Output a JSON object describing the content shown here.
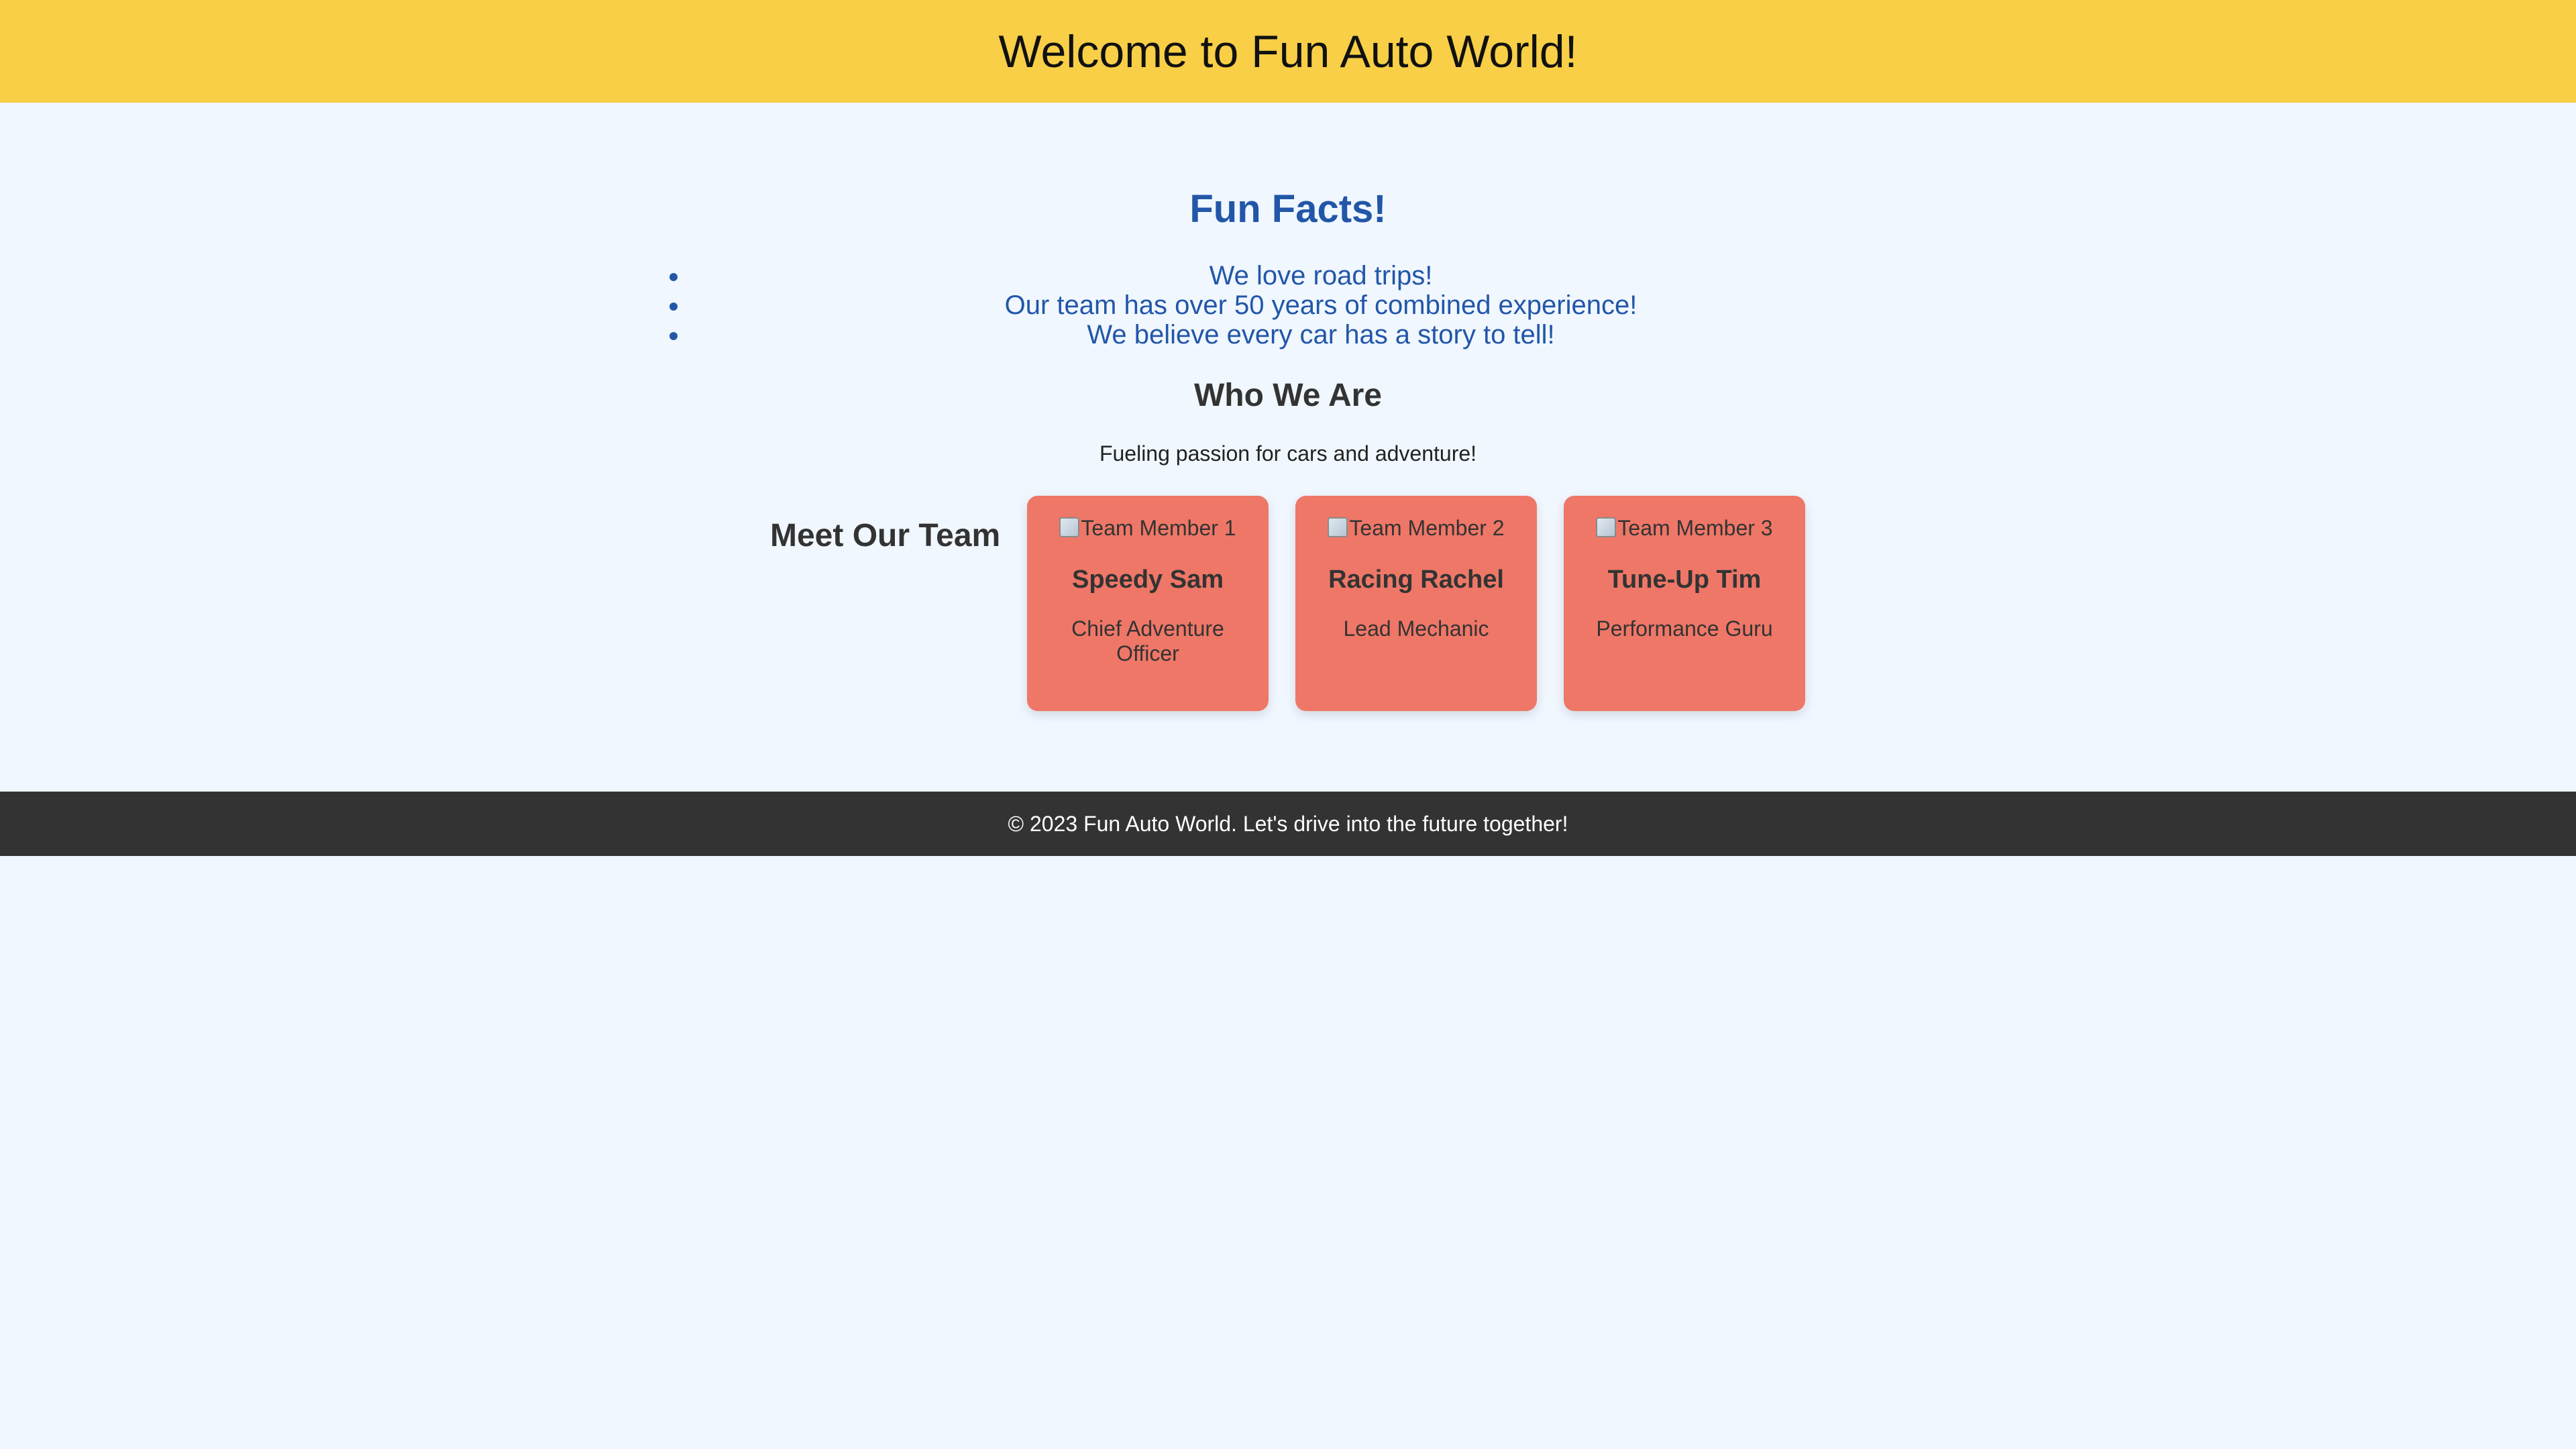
{
  "header": {
    "title": "Welcome to Fun Auto World!"
  },
  "facts": {
    "title": "Fun Facts!",
    "items": [
      "We love road trips!",
      "Our team has over 50 years of combined experience!",
      "We believe every car has a story to tell!"
    ]
  },
  "about": {
    "title": "Who We Are",
    "subtitle": "Fueling passion for cars and adventure!"
  },
  "team": {
    "title": "Meet Our Team",
    "members": [
      {
        "image_alt": "Team Member 1",
        "name": "Speedy Sam",
        "role": "Chief Adventure Officer"
      },
      {
        "image_alt": "Team Member 2",
        "name": "Racing Rachel",
        "role": "Lead Mechanic"
      },
      {
        "image_alt": "Team Member 3",
        "name": "Tune-Up Tim",
        "role": "Performance Guru"
      }
    ]
  },
  "footer": {
    "text": "© 2023 Fun Auto World. Let's drive into the future together!"
  },
  "colors": {
    "header_bg": "#f8cf46",
    "page_bg": "#f0f7ff",
    "accent_blue": "#2256a8",
    "card_bg": "#ef7767",
    "footer_bg": "#333333"
  }
}
